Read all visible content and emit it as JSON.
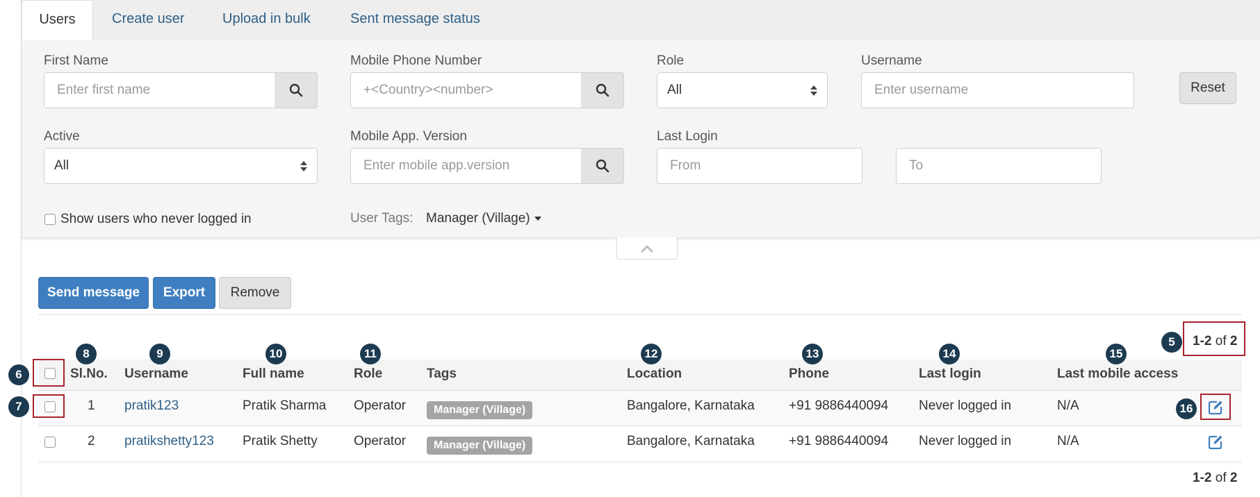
{
  "tabs": [
    "Users",
    "Create user",
    "Upload in bulk",
    "Sent message status"
  ],
  "filters": {
    "first_name": {
      "label": "First Name",
      "placeholder": "Enter first name"
    },
    "mobile_phone": {
      "label": "Mobile Phone Number",
      "placeholder": "+<Country><number>"
    },
    "role": {
      "label": "Role",
      "value": "All"
    },
    "username": {
      "label": "Username",
      "placeholder": "Enter username"
    },
    "reset_label": "Reset",
    "active": {
      "label": "Active",
      "value": "All"
    },
    "app_version": {
      "label": "Mobile App. Version",
      "placeholder": "Enter mobile app.version"
    },
    "last_login": {
      "label": "Last Login",
      "from_placeholder": "From",
      "to_placeholder": "To"
    },
    "never_logged_label": "Show users who never logged in",
    "user_tags": {
      "label": "User Tags:",
      "value": "Manager (Village)"
    }
  },
  "actions": {
    "send_message": "Send message",
    "export": "Export",
    "remove": "Remove"
  },
  "pagination": {
    "range": "1-2",
    "of_label": "of",
    "total": "2"
  },
  "table": {
    "columns": [
      "Sl.No.",
      "Username",
      "Full name",
      "Role",
      "Tags",
      "Location",
      "Phone",
      "Last login",
      "Last mobile access"
    ],
    "rows": [
      {
        "sl": "1",
        "username": "pratik123",
        "full_name": "Pratik Sharma",
        "role": "Operator",
        "tag": "Manager (Village)",
        "location": "Bangalore, Karnataka",
        "phone": "+91 9886440094",
        "last_login": "Never logged in",
        "last_mobile": "N/A"
      },
      {
        "sl": "2",
        "username": "pratikshetty123",
        "full_name": "Pratik Shetty",
        "role": "Operator",
        "tag": "Manager (Village)",
        "location": "Bangalore, Karnataka",
        "phone": "+91 9886440094",
        "last_login": "Never logged in",
        "last_mobile": "N/A"
      }
    ]
  },
  "callouts": [
    "5",
    "6",
    "7",
    "8",
    "9",
    "10",
    "11",
    "12",
    "13",
    "14",
    "15",
    "16"
  ],
  "colors": {
    "primary": "#3f7fc1",
    "link": "#2e5f87",
    "callout": "#1c3b50",
    "highlight": "#a8232b",
    "tag": "#a4a4a4"
  }
}
